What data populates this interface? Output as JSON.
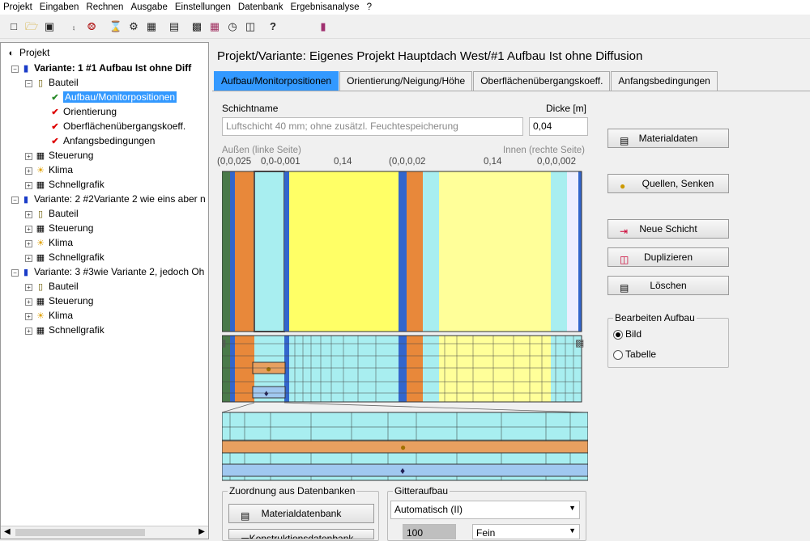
{
  "menu": [
    "Projekt",
    "Eingaben",
    "Rechnen",
    "Ausgabe",
    "Einstellungen",
    "Datenbank",
    "Ergebnisanalyse",
    "?"
  ],
  "toolbar": {
    "help": "?"
  },
  "tree": {
    "root": "Projekt",
    "v1": "Variante: 1 #1 Aufbau Ist ohne Diff",
    "v1_bauteil": "Bauteil",
    "v1_b1": "Aufbau/Monitorpositionen",
    "v1_b2": "Orientierung",
    "v1_b3": "Oberflächenübergangskoeff.",
    "v1_b4": "Anfangsbedingungen",
    "v1_steuerung": "Steuerung",
    "v1_klima": "Klima",
    "v1_schnell": "Schnellgrafik",
    "v2": "Variante: 2 #2Variante 2 wie eins aber n",
    "v2_bauteil": "Bauteil",
    "v2_steuerung": "Steuerung",
    "v2_klima": "Klima",
    "v2_schnell": "Schnellgrafik",
    "v3": "Variante: 3 #3wie Variante 2, jedoch Oh",
    "v3_bauteil": "Bauteil",
    "v3_steuerung": "Steuerung",
    "v3_klima": "Klima",
    "v3_schnell": "Schnellgrafik"
  },
  "page_title": "Projekt/Variante:  Eigenes Projekt Hauptdach West/#1 Aufbau Ist ohne Diffusion",
  "tabs": [
    "Aufbau/Monitorpositionen",
    "Orientierung/Neigung/Höhe",
    "Oberflächenübergangskoeff.",
    "Anfangsbedingungen"
  ],
  "form": {
    "schichtname_label": "Schichtname",
    "schichtname_value": "Luftschicht 40 mm; ohne zusätzl. Feuchtespeicherung",
    "dicke_label": "Dicke [m]",
    "dicke_value": "0,04"
  },
  "axis": {
    "left_label": "Außen (linke Seite)",
    "right_label": "Innen (rechte Seite)",
    "t1": "(0,0,025",
    "t2": "0,0-0,001",
    "t3": "0,14",
    "t4": "(0,0,0,02",
    "t5": "0,14",
    "t6": "0,0,0,002"
  },
  "buttons": {
    "materialdaten": "Materialdaten",
    "quellen": "Quellen, Senken",
    "neue_schicht": "Neue Schicht",
    "duplizieren": "Duplizieren",
    "loeschen": "Löschen"
  },
  "bearbeiten": {
    "label": "Bearbeiten Aufbau",
    "bild": "Bild",
    "tabelle": "Tabelle",
    "selected": "Bild"
  },
  "zuordnung": {
    "label": "Zuordnung aus Datenbanken",
    "materialdatenbank": "Materialdatenbank",
    "second": "Konstruktionsdatenbank"
  },
  "gitter": {
    "label": "Gitteraufbau",
    "mode": "Automatisch (II)",
    "count": "100",
    "fein": "Fein"
  },
  "colors": {
    "accent": "#3399ff",
    "yellow": "#ffff80",
    "orange": "#e8883a",
    "cyan": "#a8eef0",
    "green": "#4a7a4a",
    "blue": "#3366cc"
  }
}
